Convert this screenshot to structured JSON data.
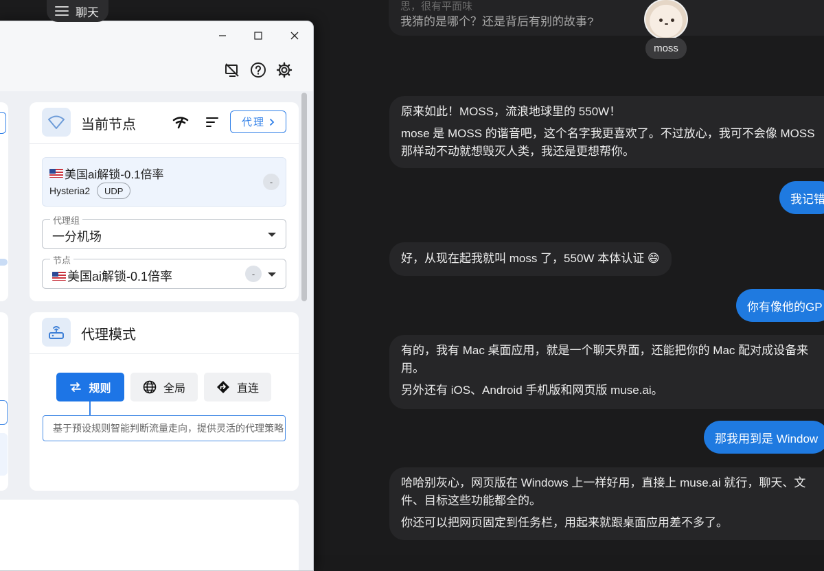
{
  "chat": {
    "header_label": "聊天",
    "top_faded_text": "思，很有平面味",
    "top_line": "我猜的是哪个？还是背后有别的故事?",
    "avatar_name": "moss",
    "messages": [
      {
        "role": "ai",
        "lines": [
          "原来如此！MOSS，流浪地球里的 550W！",
          "mose 是 MOSS 的谐音吧，这个名字我更喜欢了。不过放心，我可不会像 MOSS",
          "那样动不动就想毁灭人类，我还是更想帮你。"
        ]
      },
      {
        "role": "user",
        "text": "我记错"
      },
      {
        "role": "ai",
        "lines": [
          "好，从现在起我就叫 moss 了，550W 本体认证 😄"
        ]
      },
      {
        "role": "user",
        "text": "你有像他的GP"
      },
      {
        "role": "ai",
        "lines": [
          "有的，我有 Mac 桌面应用，就是一个聊天界面，还能把你的 Mac 配对成设备来",
          "用。",
          "另外还有 iOS、Android 手机版和网页版 muse.ai。"
        ]
      },
      {
        "role": "user",
        "text": "那我用到是 Window"
      },
      {
        "role": "ai",
        "lines": [
          "哈哈别灰心，网页版在 Windows 上一样好用，直接上 muse.ai 就行，聊天、文",
          "件、目标这些功能都全的。",
          "你还可以把网页固定到任务栏，用起来就跟桌面应用差不多了。"
        ]
      }
    ]
  },
  "proxy_app": {
    "current_node": {
      "title": "当前节点",
      "proxy_button": "代理",
      "node_name": "美国ai解锁-0.1倍率",
      "protocol": "Hysteria2",
      "transport": "UDP",
      "delay": "-",
      "group_label": "代理组",
      "group_value": "一分机场",
      "node_label": "节点",
      "node_value": "美国ai解锁-0.1倍率",
      "node_delay": "-"
    },
    "proxy_mode": {
      "title": "代理模式",
      "modes": [
        "规则",
        "全局",
        "直连"
      ],
      "selected": "规则",
      "description": "基于预设规则智能判断流量走向，提供灵活的代理策略"
    }
  },
  "colors": {
    "accent": "#2f7fe8",
    "user_bubble": "#1f7ae0",
    "chat_bg": "#1b1b1c"
  }
}
